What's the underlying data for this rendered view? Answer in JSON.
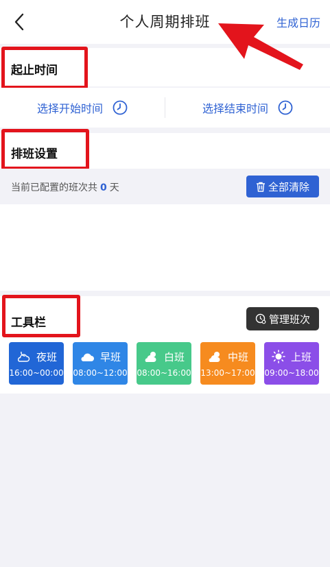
{
  "header": {
    "title": "个人周期排班",
    "action_label": "生成日历"
  },
  "period": {
    "title": "起止时间",
    "start_label": "选择开始时间",
    "end_label": "选择结束时间"
  },
  "schedule": {
    "title": "排班设置",
    "info_prefix": "当前已配置的班次共",
    "count": "0",
    "info_suffix": "天",
    "clear_label": "全部清除"
  },
  "toolbar": {
    "title": "工具栏",
    "manage_label": "管理班次",
    "shifts": [
      {
        "name": "夜班",
        "time": "16:00~00:00",
        "color": "#2166d6",
        "icon": "moon-cloud-icon"
      },
      {
        "name": "早班",
        "time": "08:00~12:00",
        "color": "#2f86e6",
        "icon": "cloud-icon"
      },
      {
        "name": "白班",
        "time": "08:00~16:00",
        "color": "#47c98a",
        "icon": "sun-cloud-icon"
      },
      {
        "name": "中班",
        "time": "13:00~17:00",
        "color": "#f68b1f",
        "icon": "sun-cloud-icon"
      },
      {
        "name": "上班",
        "time": "09:00~18:00",
        "color": "#8b4ee8",
        "icon": "sun-icon"
      }
    ]
  },
  "colors": {
    "accent": "#2f62d3",
    "highlight": "#e3141c"
  }
}
